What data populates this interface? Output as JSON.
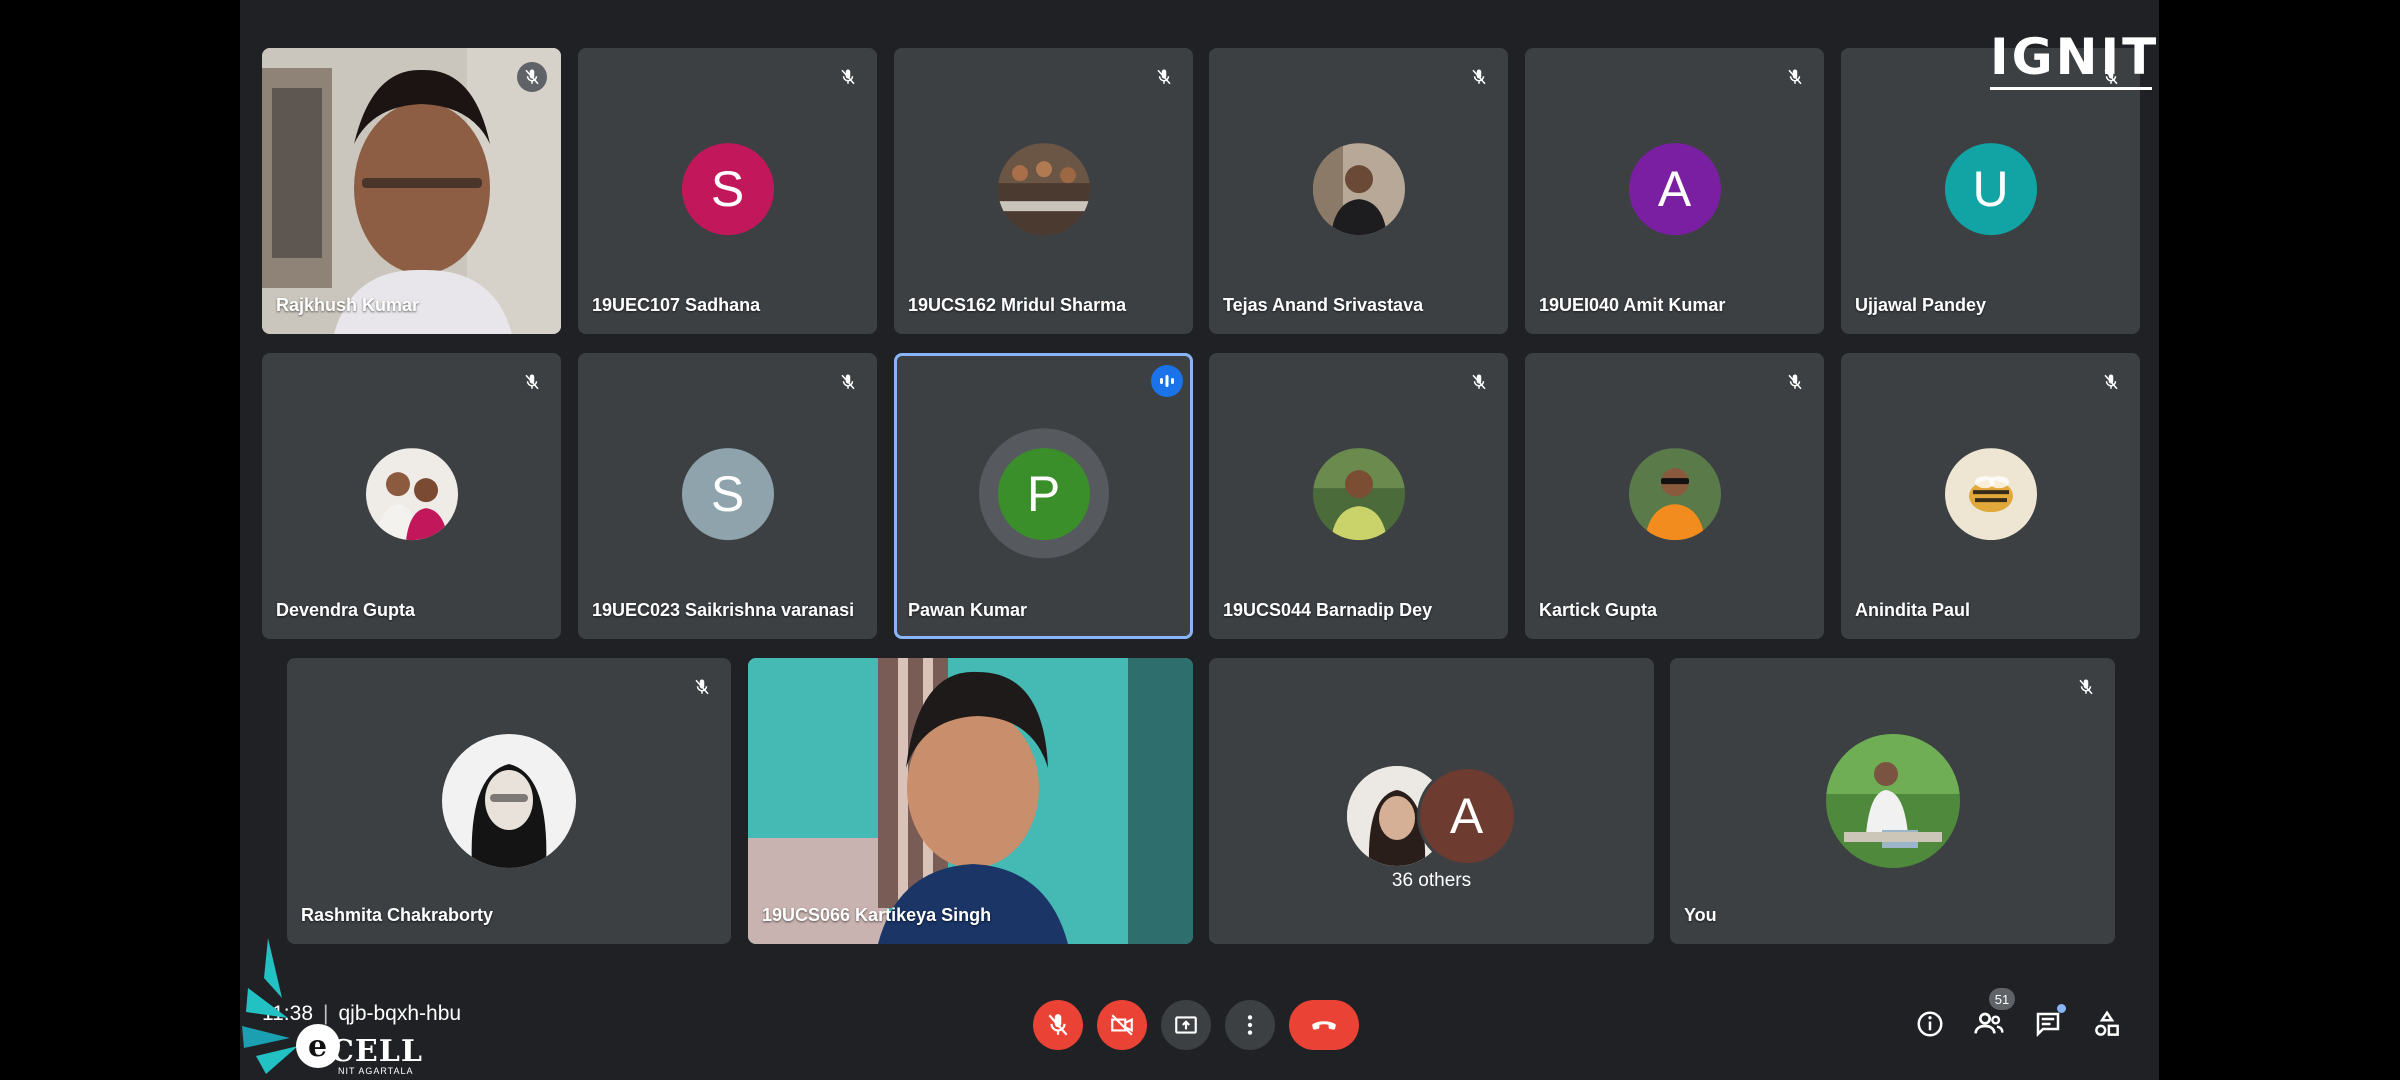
{
  "overlay": {
    "brand_logo": "IGNITE",
    "org_logo_main": "CELL",
    "org_logo_sub": "NIT AGARTALA"
  },
  "grid": {
    "row1": [
      {
        "name": "Rajkhush Kumar",
        "type": "video",
        "muted": true
      },
      {
        "name": "19UEC107 Sadhana",
        "type": "letter",
        "letter": "S",
        "color": "#c2185b",
        "muted": true
      },
      {
        "name": "19UCS162 Mridul Sharma",
        "type": "photo",
        "muted": true
      },
      {
        "name": "Tejas Anand Srivastava",
        "type": "photo",
        "muted": true
      },
      {
        "name": "19UEI040 Amit Kumar",
        "type": "letter",
        "letter": "A",
        "color": "#7b1fa2",
        "muted": true
      },
      {
        "name": "Ujjawal Pandey",
        "type": "letter",
        "letter": "U",
        "color": "#12a4a4",
        "muted": true
      }
    ],
    "row2": [
      {
        "name": "Devendra Gupta",
        "type": "photo",
        "muted": true
      },
      {
        "name": "19UEC023 Saikrishna varanasi",
        "type": "letter",
        "letter": "S",
        "color": "#8fa3ad",
        "muted": true
      },
      {
        "name": "Pawan Kumar",
        "type": "letter",
        "letter": "P",
        "color": "#3b8f2a",
        "muted": false,
        "speaking": true
      },
      {
        "name": "19UCS044 Barnadip Dey",
        "type": "photo",
        "muted": true
      },
      {
        "name": "Kartick Gupta",
        "type": "photo",
        "muted": true
      },
      {
        "name": "Anindita Paul",
        "type": "photo",
        "muted": true
      }
    ],
    "row3": [
      {
        "name": "Rashmita Chakraborty",
        "type": "photo",
        "muted": true
      },
      {
        "name": "19UCS066 Kartikeya Singh",
        "type": "video",
        "muted": false
      },
      {
        "others_label": "36 others",
        "letter": "A",
        "color": "#6d3b30"
      },
      {
        "name": "You",
        "type": "photo",
        "muted": true
      }
    ]
  },
  "bottom_bar": {
    "time": "11:38",
    "separator": "|",
    "meeting_code": "qjb-bqxh-hbu",
    "participants_count": "51"
  },
  "colors": {
    "accent_red": "#ea4335",
    "active_speaker": "#8ab4f8",
    "tile_bg": "#3c4043",
    "surface": "#202124"
  }
}
